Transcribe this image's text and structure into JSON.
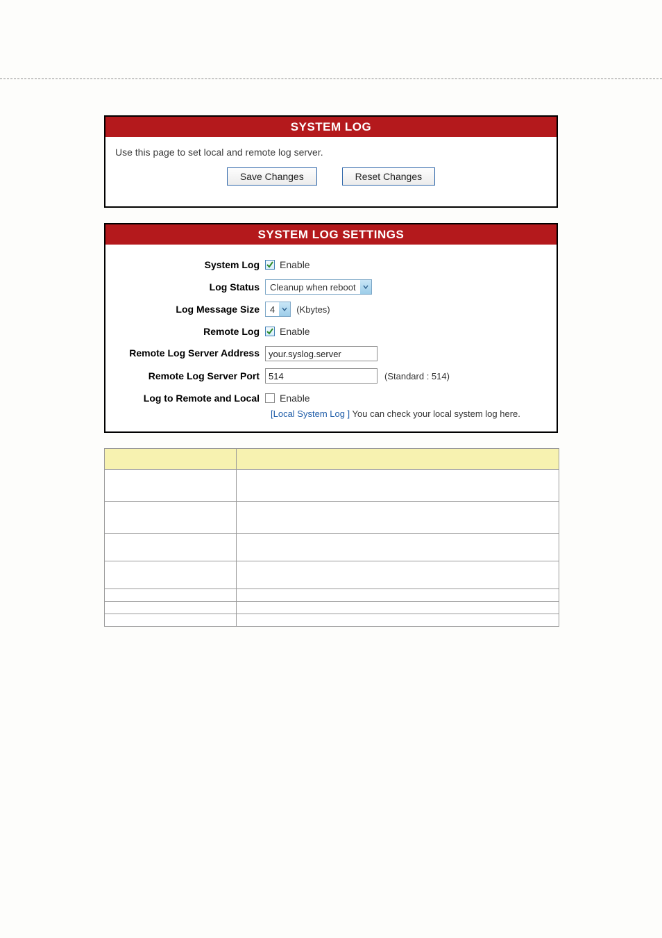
{
  "panel1": {
    "title": "SYSTEM LOG",
    "description": "Use this page to set local and remote log server.",
    "save_btn": "Save Changes",
    "reset_btn": "Reset Changes"
  },
  "panel2": {
    "title": "SYSTEM LOG SETTINGS",
    "rows": {
      "system_log_label": "System Log",
      "system_log_enable": "Enable",
      "log_status_label": "Log Status",
      "log_status_value": "Cleanup when reboot",
      "log_msg_size_label": "Log Message Size",
      "log_msg_size_value": "4",
      "log_msg_size_unit": "(Kbytes)",
      "remote_log_label": "Remote Log",
      "remote_log_enable": "Enable",
      "remote_server_label": "Remote Log Server Address",
      "remote_server_value": "your.syslog.server",
      "remote_port_label": "Remote Log Server Port",
      "remote_port_value": "514",
      "remote_port_note": "(Standard : 514)",
      "log_both_label": "Log to Remote and Local",
      "log_both_enable": "Enable",
      "note_link": "[Local System Log ]",
      "note_rest": " You can check your local system log here."
    }
  }
}
